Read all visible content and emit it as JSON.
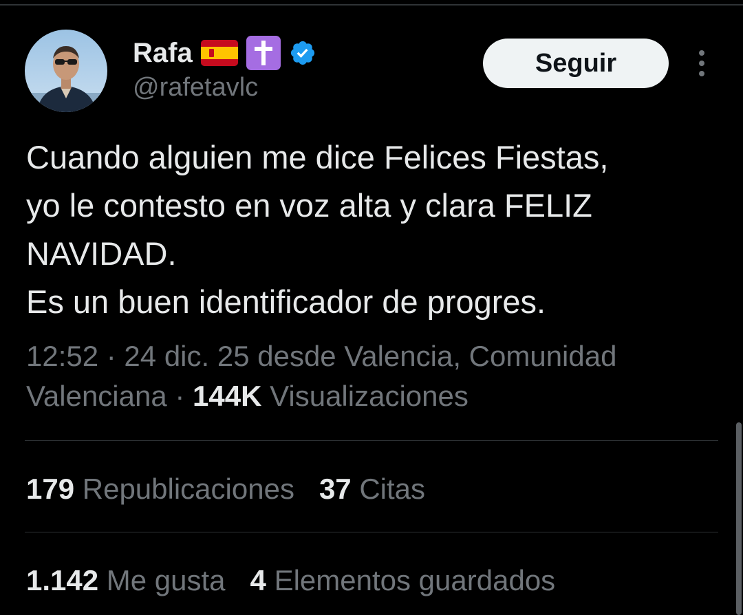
{
  "author": {
    "name": "Rafa",
    "handle": "@rafetavlc",
    "badges": [
      "spain-flag-icon",
      "latin-cross-icon",
      "verified-badge-icon"
    ],
    "verified_color": "#1d9bf0"
  },
  "follow_button": {
    "label": "Seguir"
  },
  "tweet": {
    "lines": [
      "Cuando alguien me dice Felices Fiestas,",
      "yo le contesto en voz alta y clara FELIZ",
      "NAVIDAD.",
      "Es un buen identificador de progres."
    ]
  },
  "meta": {
    "line1": "12:52 · 24 dic. 25 desde Valencia, Comunidad",
    "line2_prefix": "Valenciana · ",
    "views_count": "144K",
    "views_label": " Visualizaciones"
  },
  "stats": {
    "reposts_count": "179",
    "reposts_label": "Republicaciones",
    "quotes_count": "37",
    "quotes_label": "Citas",
    "likes_count": "1.142",
    "likes_label": "Me gusta",
    "bookmarks_count": "4",
    "bookmarks_label": "Elementos guardados"
  },
  "colors": {
    "background": "#000000",
    "text_primary": "#e7e9ea",
    "text_secondary": "#71767b",
    "divider": "#2f3336",
    "button_bg": "#eff3f4"
  }
}
